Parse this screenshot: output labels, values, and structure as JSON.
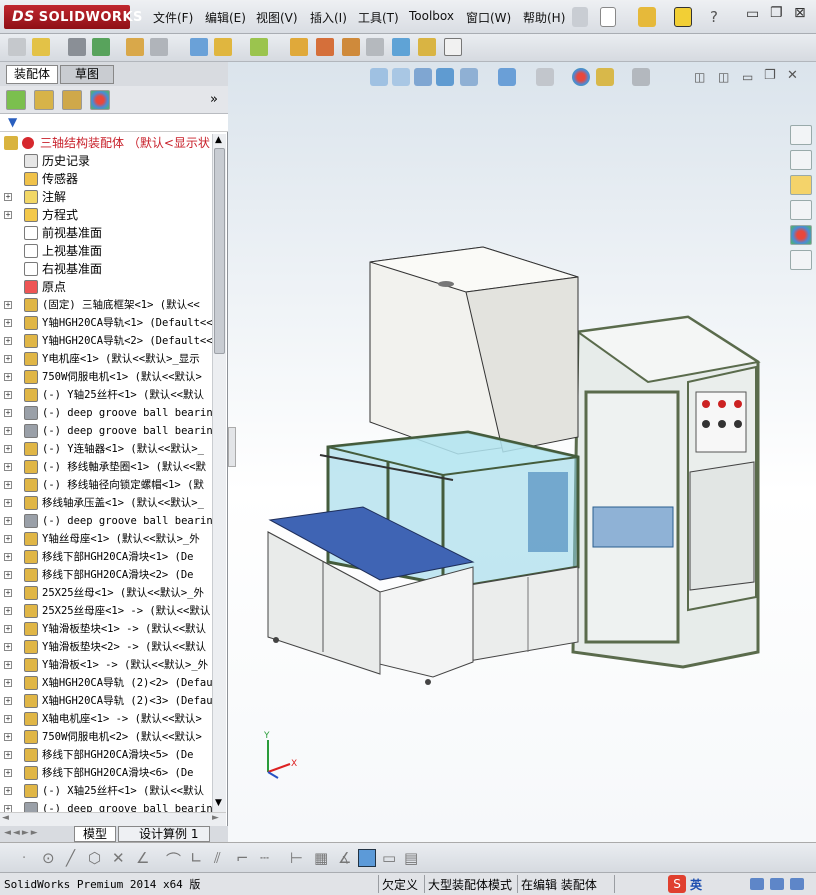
{
  "app": {
    "logo_prefix": "DS",
    "logo_text": "SOLIDWORKS"
  },
  "menu": [
    {
      "label": "文件(F)"
    },
    {
      "label": "编辑(E)"
    },
    {
      "label": "视图(V)"
    },
    {
      "label": "插入(I)"
    },
    {
      "label": "工具(T)"
    },
    {
      "label": "Toolbox"
    },
    {
      "label": "窗口(W)"
    },
    {
      "label": "帮助(H)"
    }
  ],
  "panel_tabs": {
    "assembly": "装配体",
    "sketch": "草图"
  },
  "panel_more": "»",
  "tree": {
    "root": "三轴结构装配体 （默认<显示状",
    "items": [
      {
        "label": "历史记录",
        "expand": false,
        "icon": "history-icon"
      },
      {
        "label": "传感器",
        "expand": false,
        "icon": "sensor-icon"
      },
      {
        "label": "注解",
        "expand": true,
        "icon": "annotation-icon"
      },
      {
        "label": "方程式",
        "expand": true,
        "icon": "equation-icon"
      },
      {
        "label": "前视基准面",
        "expand": false,
        "icon": "plane-icon"
      },
      {
        "label": "上视基准面",
        "expand": false,
        "icon": "plane-icon"
      },
      {
        "label": "右视基准面",
        "expand": false,
        "icon": "plane-icon"
      },
      {
        "label": "原点",
        "expand": false,
        "icon": "origin-icon"
      },
      {
        "label": "(固定) 三轴底框架<1> (默认<<",
        "expand": true,
        "icon": "part-icon"
      },
      {
        "label": "Y轴HGH20CA导轨<1> (Default<<",
        "expand": true,
        "icon": "part-icon"
      },
      {
        "label": "Y轴HGH20CA导轨<2> (Default<<",
        "expand": true,
        "icon": "part-icon"
      },
      {
        "label": "Y电机座<1> (默认<<默认>_显示",
        "expand": true,
        "icon": "part-icon"
      },
      {
        "label": "750W伺服电机<1> (默认<<默认>",
        "expand": true,
        "icon": "part-icon"
      },
      {
        "label": "(-) Y轴25丝杆<1> (默认<<默认",
        "expand": true,
        "icon": "part-icon"
      },
      {
        "label": "(-) deep groove ball bearing",
        "expand": true,
        "icon": "bearing-icon"
      },
      {
        "label": "(-) deep groove ball bearing",
        "expand": true,
        "icon": "bearing-icon"
      },
      {
        "label": "(-) Y连轴器<1> (默认<<默认>_",
        "expand": true,
        "icon": "part-icon"
      },
      {
        "label": "(-) 移线軸承垫圈<1> (默认<<默",
        "expand": true,
        "icon": "part-icon"
      },
      {
        "label": "(-) 移线轴径向锁定螺帽<1> (默",
        "expand": true,
        "icon": "part-icon"
      },
      {
        "label": "移线轴承压盖<1> (默认<<默认>_",
        "expand": true,
        "icon": "part-icon"
      },
      {
        "label": "(-) deep groove ball bearing",
        "expand": true,
        "icon": "bearing-icon"
      },
      {
        "label": "Y轴丝母座<1> (默认<<默认>_外",
        "expand": true,
        "icon": "part-icon"
      },
      {
        "label": "移线下部HGH20CA滑块<1> (De",
        "expand": true,
        "icon": "part-icon"
      },
      {
        "label": "移线下部HGH20CA滑块<2> (De",
        "expand": true,
        "icon": "part-icon"
      },
      {
        "label": "25X25丝母<1> (默认<<默认>_外",
        "expand": true,
        "icon": "part-icon"
      },
      {
        "label": "25X25丝母座<1> -> (默认<<默认",
        "expand": true,
        "icon": "part-icon"
      },
      {
        "label": "Y轴滑板垫块<1> -> (默认<<默认",
        "expand": true,
        "icon": "part-icon"
      },
      {
        "label": "Y轴滑板垫块<2> -> (默认<<默认",
        "expand": true,
        "icon": "part-icon"
      },
      {
        "label": "Y轴滑板<1> -> (默认<<默认>_外",
        "expand": true,
        "icon": "part-icon"
      },
      {
        "label": "X轴HGH20CA导轨 (2)<2> (Defau",
        "expand": true,
        "icon": "part-icon"
      },
      {
        "label": "X轴HGH20CA导轨 (2)<3> (Defau",
        "expand": true,
        "icon": "part-icon"
      },
      {
        "label": "X轴电机座<1> -> (默认<<默认>",
        "expand": true,
        "icon": "part-icon"
      },
      {
        "label": "750W伺服电机<2> (默认<<默认>",
        "expand": true,
        "icon": "part-icon"
      },
      {
        "label": "移线下部HGH20CA滑块<5> (De",
        "expand": true,
        "icon": "part-icon"
      },
      {
        "label": "移线下部HGH20CA滑块<6> (De",
        "expand": true,
        "icon": "part-icon"
      },
      {
        "label": "(-) X轴25丝杆<1> (默认<<默认",
        "expand": true,
        "icon": "part-icon"
      },
      {
        "label": "(-) deep groove ball bearing",
        "expand": true,
        "icon": "bearing-icon"
      }
    ]
  },
  "bottom_tabs": {
    "model": "模型",
    "study": "设计算例 1"
  },
  "status": {
    "product": "SolidWorks Premium 2014 x64 版",
    "defined": "欠定义",
    "mode": "大型装配体模式",
    "editing": "在编辑 装配体",
    "ime": "英"
  },
  "colors": {
    "brand_red": "#b3222a",
    "frame_green": "#5a6b4c",
    "glass_blue": "#8fd3e6",
    "sheet_grey": "#e9ebea",
    "plate_blue": "#3f64b4"
  }
}
